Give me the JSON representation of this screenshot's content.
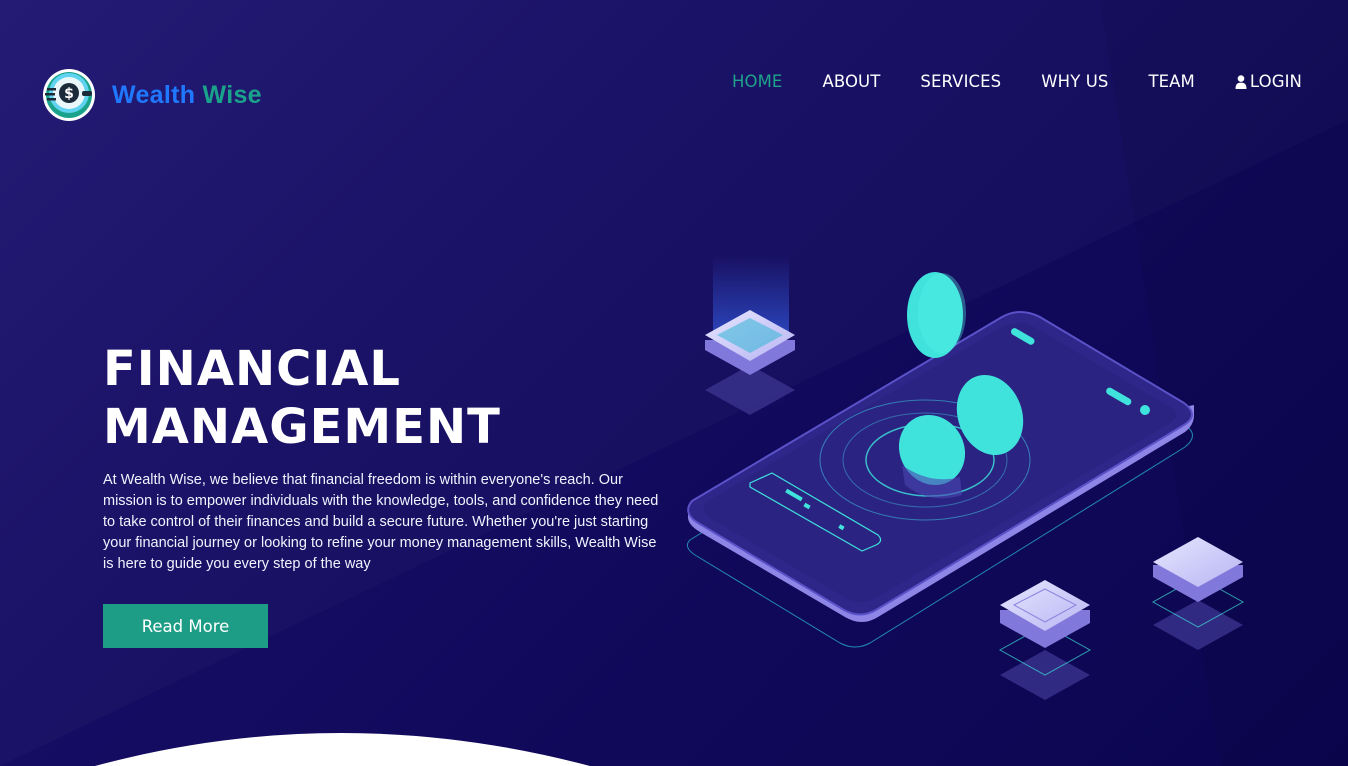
{
  "brand": {
    "name_part1": "Wealth",
    "name_part2": "Wise",
    "logo_icon": "dollar-coin-icon"
  },
  "nav": {
    "items": [
      {
        "label": "HOME",
        "active": true
      },
      {
        "label": "ABOUT",
        "active": false
      },
      {
        "label": "SERVICES",
        "active": false
      },
      {
        "label": "WHY US",
        "active": false
      },
      {
        "label": "TEAM",
        "active": false
      }
    ],
    "login": {
      "label": "LOGIN",
      "icon": "user-icon"
    }
  },
  "hero": {
    "title_line1": "FINANCIAL",
    "title_line2": "MANAGEMENT",
    "description": "At Wealth Wise, we believe that financial freedom is within everyone's reach. Our mission is to empower individuals with the knowledge, tools, and confidence they need to take control of their finances and build a secure future. Whether you're just starting your financial journey or looking to refine your money management skills, Wealth Wise is here to guide you every step of the way",
    "button_label": "Read More"
  },
  "colors": {
    "background": "#150d63",
    "accent": "#1e9d86",
    "brand_blue": "#1f78ff",
    "brand_green": "#1aa38a",
    "coin": "#3fe3dc"
  }
}
